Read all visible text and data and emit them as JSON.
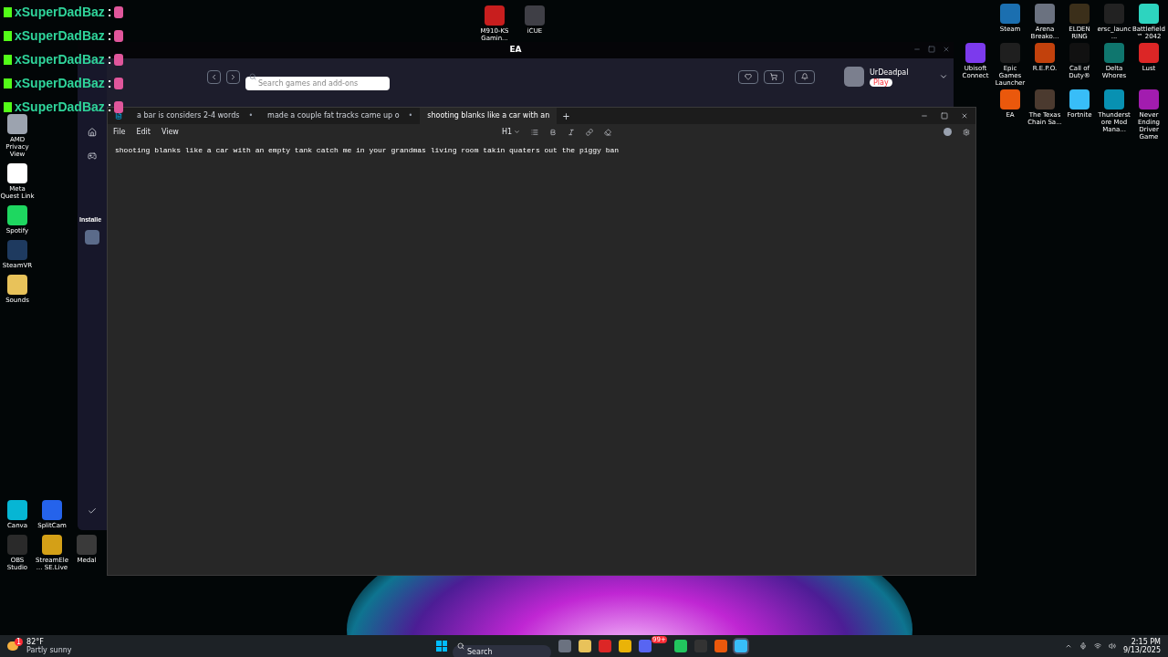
{
  "chat_overlay": [
    {
      "name": "xSuperDadBaz",
      "separator": ":"
    },
    {
      "name": "xSuperDadBaz",
      "separator": ":"
    },
    {
      "name": "xSuperDadBaz",
      "separator": ":"
    },
    {
      "name": "xSuperDadBaz",
      "separator": ":"
    },
    {
      "name": "xSuperDadBaz",
      "separator": ":"
    }
  ],
  "desktop_left": [
    {
      "label": "AMD Privacy View",
      "color": "#9ca3af"
    },
    {
      "label": "Meta Quest Link",
      "color": "#ffffff"
    },
    {
      "label": "Spotify",
      "color": "#1ed760"
    },
    {
      "label": "SteamVR",
      "color": "#1e3a5f"
    },
    {
      "label": "Sounds",
      "color": "#e8c25a"
    }
  ],
  "desktop_top": [
    {
      "label": "M910-KS Gamin...",
      "color": "#c81e1e"
    },
    {
      "label": "iCUE",
      "color": "#3f3f46"
    }
  ],
  "desktop_right": [
    [
      {
        "label": "Steam",
        "color": "#1b6fb0"
      },
      {
        "label": "Arena Breako...",
        "color": "#6b7280"
      },
      {
        "label": "ELDEN RING",
        "color": "#3b2f1a"
      },
      {
        "label": "ersc_launc...",
        "color": "#222222"
      },
      {
        "label": "Battlefield™ 2042",
        "color": "#2dd4bf"
      }
    ],
    [
      {
        "label": "Ubisoft Connect",
        "color": "#7c3aed"
      },
      {
        "label": "Epic Games Launcher",
        "color": "#1f1f1f"
      },
      {
        "label": "R.E.P.O.",
        "color": "#c2410c"
      },
      {
        "label": "Call of Duty®",
        "color": "#111111"
      },
      {
        "label": "Delta Whores",
        "color": "#0f766e"
      },
      {
        "label": "Lust",
        "color": "#dc2626"
      }
    ],
    [
      {
        "label": "EA",
        "color": "#ea580c"
      },
      {
        "label": "The Texas Chain Sa...",
        "color": "#4b3a2f"
      },
      {
        "label": "Fortnite",
        "color": "#38bdf8"
      },
      {
        "label": "Thunderstore Mod Mana...",
        "color": "#0891b2"
      },
      {
        "label": "Never Ending Driver Game",
        "color": "#a21caf"
      }
    ]
  ],
  "desktop_bottom_left": [
    [
      {
        "label": "Canva",
        "color": "#06b6d4"
      },
      {
        "label": "SplitCam",
        "color": "#2563eb"
      }
    ],
    [
      {
        "label": "OBS Studio",
        "color": "#2a2a2a"
      },
      {
        "label": "StreamEle... SE.Live",
        "color": "#d4a017"
      },
      {
        "label": "Medal",
        "color": "#3a3a3a"
      }
    ]
  ],
  "ea_window": {
    "title": "EA",
    "search": {
      "placeholder": "Search games and add-ons"
    },
    "user": {
      "name": "UrDeadpal",
      "status": "Play"
    },
    "sidebar_section": "Installe"
  },
  "notepad": {
    "tabs": [
      {
        "label": "a bar is considers 2-4 words",
        "marker": "•",
        "selected": false
      },
      {
        "label": "made a couple fat tracks came up o",
        "marker": "•",
        "selected": false
      },
      {
        "label": "shooting blanks like a car with an",
        "selected": true
      }
    ],
    "add_tab": "+",
    "menu": [
      "File",
      "Edit",
      "View"
    ],
    "heading_style": "H1",
    "text": "shooting blanks like a car with an empty tank catch me in your grandmas living room takin quaters out the piggy ban"
  },
  "taskbar": {
    "weather": {
      "temperature": "82°F",
      "condition": "Partly sunny",
      "badge": "1"
    },
    "search": {
      "placeholder": "Search"
    },
    "apps": [
      {
        "color": "#6b7280",
        "selected": false
      },
      {
        "color": "#e8c25a",
        "selected": false
      },
      {
        "color": "#dc2626",
        "selected": false
      },
      {
        "color": "#eab308",
        "selected": false
      },
      {
        "color": "#5865f2",
        "selected": false,
        "badge": "99+"
      },
      {
        "color": "#22c55e",
        "selected": false
      },
      {
        "color": "#333333",
        "selected": false
      },
      {
        "color": "#ea580c",
        "selected": false
      },
      {
        "color": "#38bdf8",
        "selected": true
      }
    ],
    "time": "2:15 PM",
    "date": "9/13/2025"
  }
}
